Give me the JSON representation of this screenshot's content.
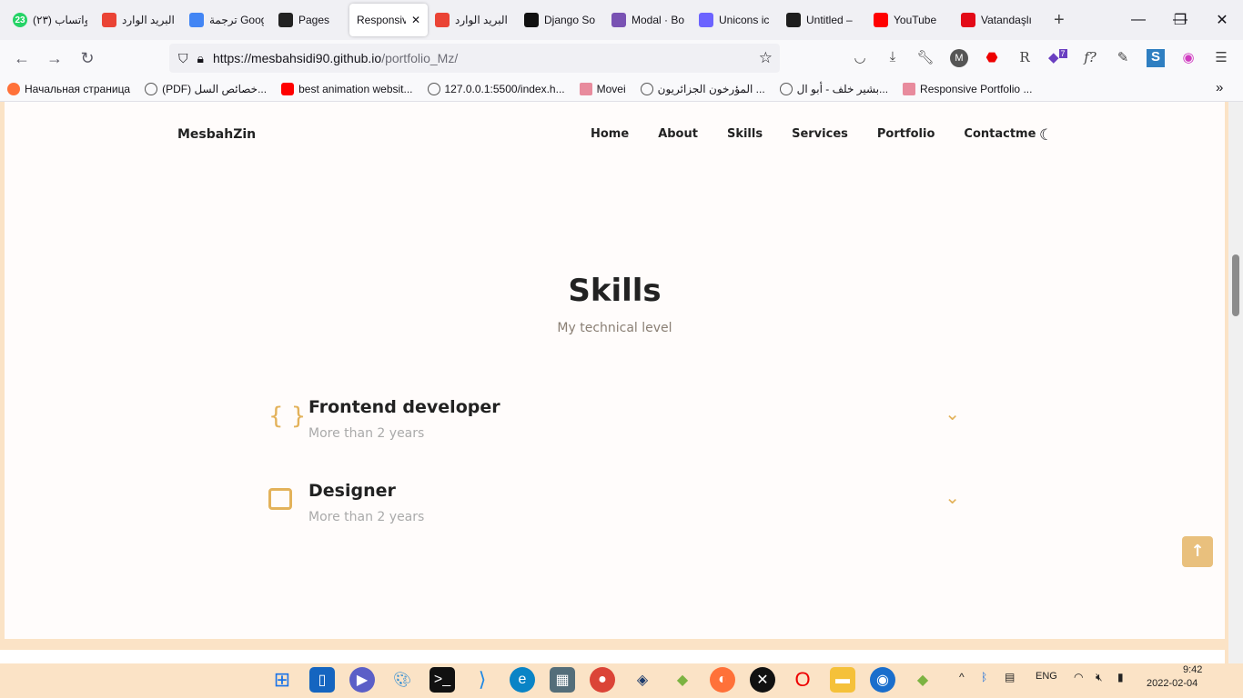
{
  "browser": {
    "tabs": [
      {
        "label": "(٢٣) واتساب",
        "icon": "whatsapp-icon",
        "color": "#25d366",
        "badge": "23"
      },
      {
        "label": "البريد الوارد",
        "icon": "gmail-icon",
        "color": "#ea4335"
      },
      {
        "label": "ترجمة Google",
        "icon": "google-translate-icon",
        "color": "#4285f4"
      },
      {
        "label": "Pages",
        "icon": "github-icon",
        "color": "#222222"
      },
      {
        "label": "Responsive",
        "icon": "",
        "color": "",
        "active": true
      },
      {
        "label": "البريد الوارد",
        "icon": "gmail-icon",
        "color": "#ea4335"
      },
      {
        "label": "Django So",
        "icon": "django-icon",
        "color": "#111111"
      },
      {
        "label": "Modal · Bo",
        "icon": "bootstrap-icon",
        "color": "#7952b3"
      },
      {
        "label": "Unicons ic",
        "icon": "unicons-icon",
        "color": "#6c63ff"
      },
      {
        "label": "Untitled –",
        "icon": "figma-icon",
        "color": "#1e1e1e"
      },
      {
        "label": "YouTube",
        "icon": "youtube-icon",
        "color": "#ff0000"
      },
      {
        "label": "Vatandaşlı",
        "icon": "vatandas-icon",
        "color": "#e30a17"
      }
    ],
    "url_host": "https://mesbahsidi90.github.io",
    "url_path": "/portfolio_Mz/",
    "extension_badge": "7",
    "bookmarks": [
      {
        "label": "Начальная страница",
        "icon": "firefox-icon"
      },
      {
        "label": "(PDF) خصائص السل...",
        "icon": "globe-icon"
      },
      {
        "label": "best animation websit...",
        "icon": "youtube-icon"
      },
      {
        "label": "127.0.0.1:5500/index.h...",
        "icon": "globe-icon"
      },
      {
        "label": "Movei",
        "icon": "m-icon"
      },
      {
        "label": "المؤرخون الجزائريون ...",
        "icon": "globe-icon"
      },
      {
        "label": "بشير خلف - أبو ال...",
        "icon": "globe-icon"
      },
      {
        "label": "Responsive Portfolio ...",
        "icon": "m-icon"
      }
    ]
  },
  "site": {
    "logo": "MesbahZin",
    "menu": [
      "Home",
      "About",
      "Skills",
      "Services",
      "Portfolio",
      "Contactme"
    ],
    "title": "Skills",
    "subtitle": "My technical level",
    "skills": [
      {
        "name": "Frontend developer",
        "years": "More than 2 years",
        "icon": "brackets-icon"
      },
      {
        "name": "Designer",
        "years": "More than 2 years",
        "icon": "swatchbook-icon"
      }
    ],
    "accent": "#e3b25a"
  },
  "taskbar": {
    "lang": "ENG",
    "time": "9:42",
    "date": "2022-02-04"
  }
}
